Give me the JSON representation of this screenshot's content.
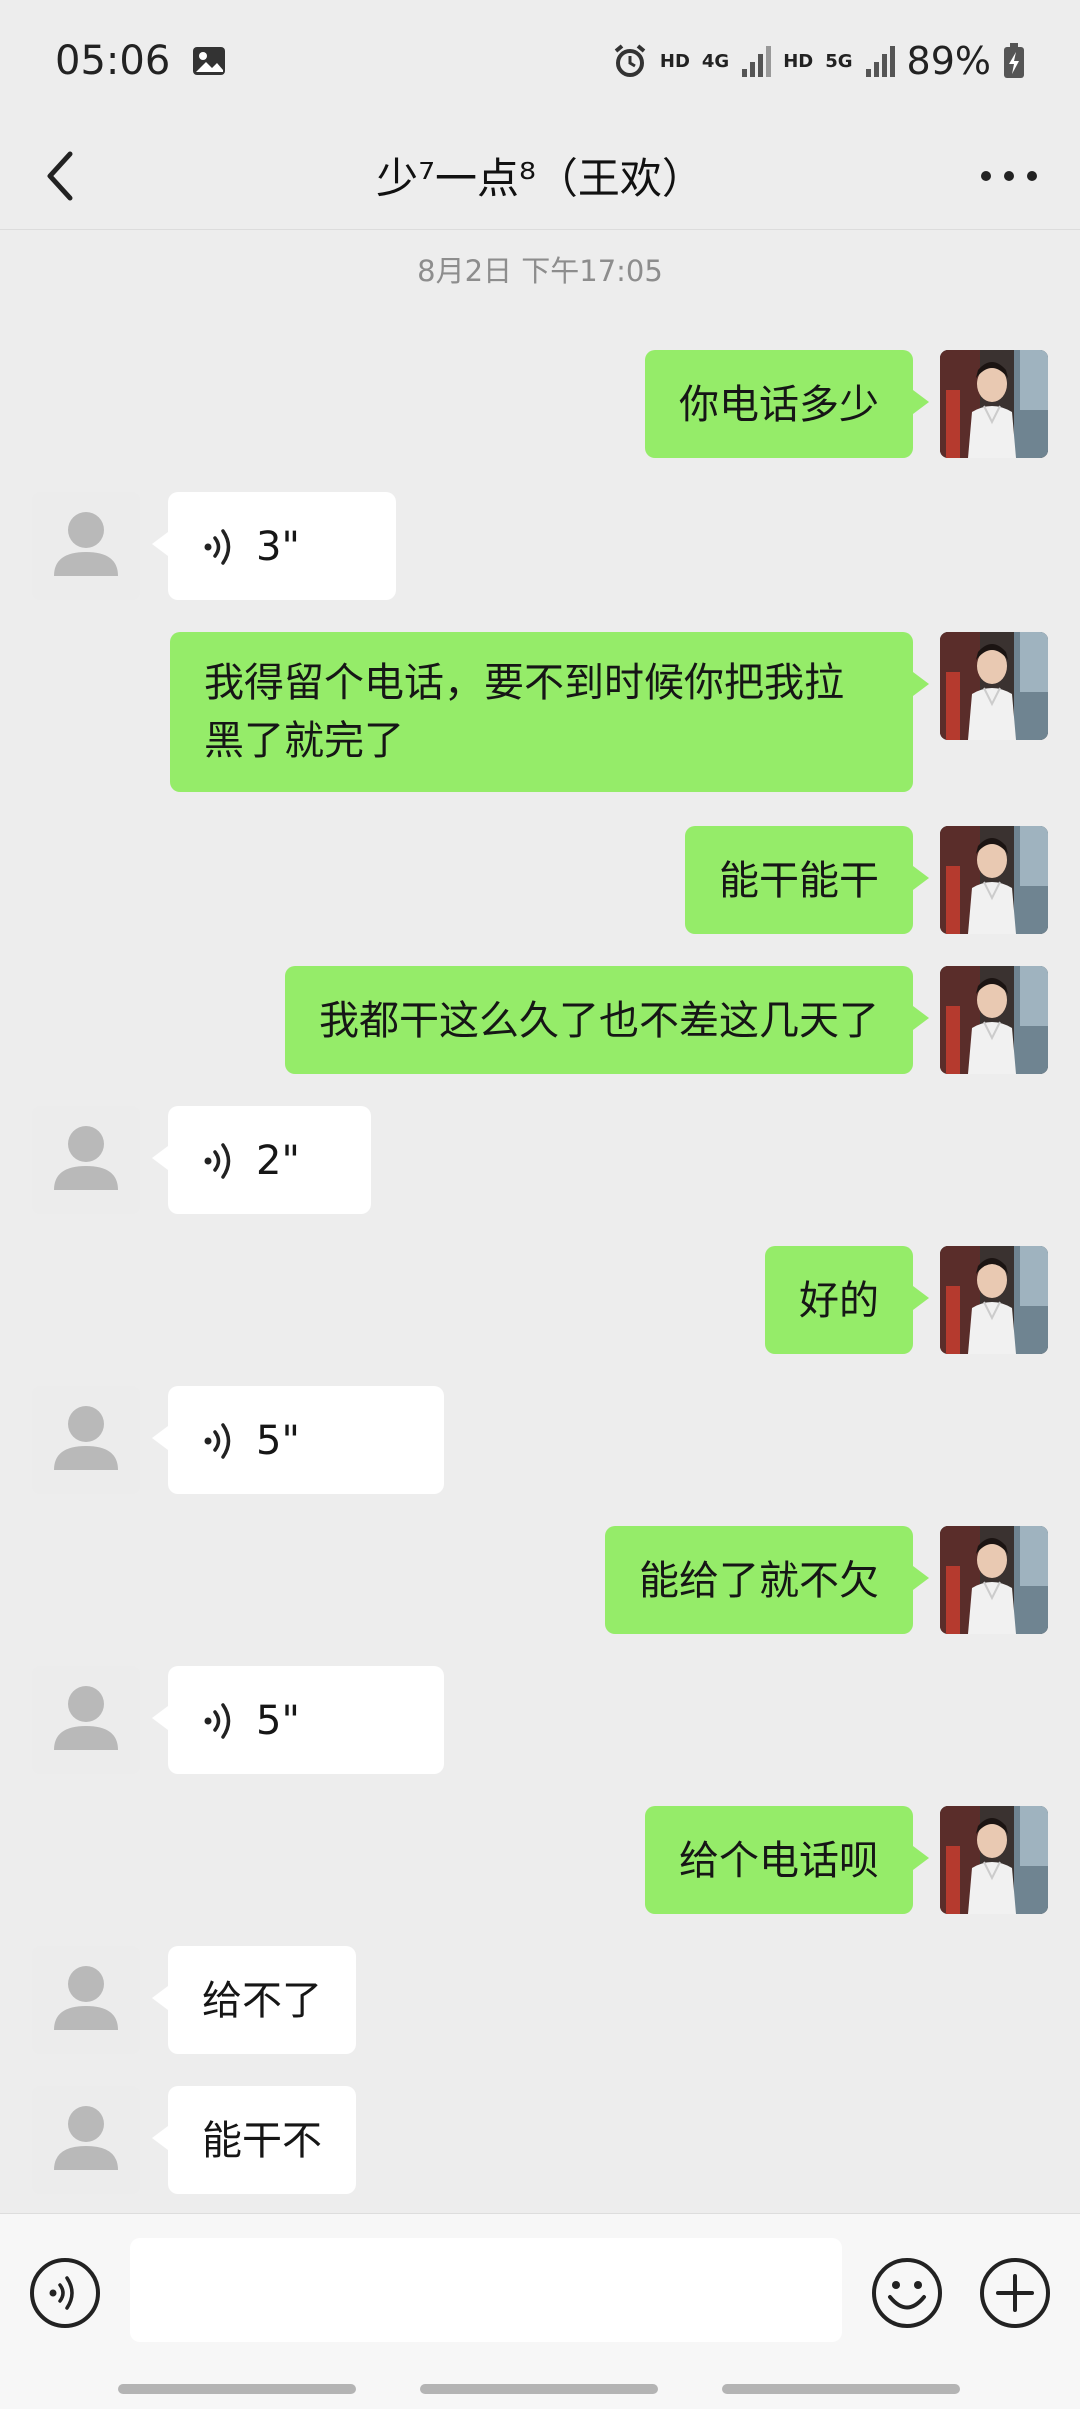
{
  "status_bar": {
    "time": "05:06",
    "hd1": "HD",
    "net1": "4G",
    "hd2": "HD",
    "net2": "5G",
    "battery": "89%"
  },
  "header": {
    "title": "少⁷一点⁸（王欢）"
  },
  "timestamp": "8月2日 下午17:05",
  "messages": [
    {
      "text": "你电话多少"
    },
    {
      "duration": "3\""
    },
    {
      "text": "我得留个电话，要不到时候你把我拉黑了就完了"
    },
    {
      "text": "能干能干"
    },
    {
      "text": "我都干这么久了也不差这几天了"
    },
    {
      "duration": "2\""
    },
    {
      "text": "好的"
    },
    {
      "duration": "5\""
    },
    {
      "text": "能给了就不欠"
    },
    {
      "duration": "5\""
    },
    {
      "text": "给个电话呗"
    },
    {
      "text": "给不了"
    },
    {
      "text": "能干不"
    }
  ],
  "input_bar": {
    "value": ""
  },
  "colors": {
    "me_bubble": "#95ec69",
    "background": "#ededed"
  }
}
